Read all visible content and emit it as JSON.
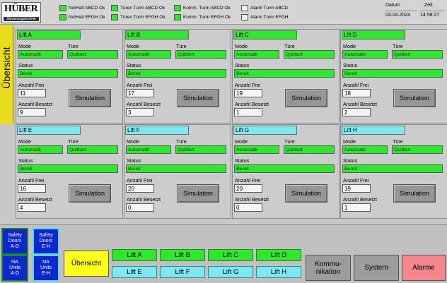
{
  "header": {
    "logo_text": "HÜBER",
    "logo_sub": "Steuerungstechnik",
    "signals": [
      {
        "label": "NotHalt ABCD Ok",
        "on": true
      },
      {
        "label": "NotHalt EFGH Ok",
        "on": true
      },
      {
        "label": "Türen Turm ABCD Ok",
        "on": true
      },
      {
        "label": "Türen Turm EFGH Ok",
        "on": true
      },
      {
        "label": "Komm. Turm ABCD Ok",
        "on": true
      },
      {
        "label": "Komm. Turm EFGH Ok",
        "on": true
      },
      {
        "label": "Alarm Turm ABCD",
        "on": false
      },
      {
        "label": "Alarm Turm EFGH",
        "on": false
      }
    ],
    "date_label": "Datum",
    "date_value": "03.04.2024",
    "time_label": "Zeit",
    "time_value": "14:58:27"
  },
  "side_tab": {
    "label": "Übersicht"
  },
  "labels": {
    "mode": "Mode",
    "door": "Türe",
    "status": "Status",
    "free": "Anzahl Frei",
    "occupied": "Anzahl Besetzt",
    "sim": "Simulation"
  },
  "lifts": [
    {
      "name": "Lift A",
      "mode": "Automatik",
      "door": "Quittiert",
      "status": "Bereit",
      "free": "11",
      "occupied": "9",
      "color": "green"
    },
    {
      "name": "Lift B",
      "mode": "Automatik",
      "door": "Quittiert",
      "status": "Bereit",
      "free": "17",
      "occupied": "3",
      "color": "green"
    },
    {
      "name": "Lift C",
      "mode": "Automatik",
      "door": "Quittiert",
      "status": "Bereit",
      "free": "19",
      "occupied": "1",
      "color": "green"
    },
    {
      "name": "Lift D",
      "mode": "Automatik",
      "door": "Quittiert",
      "status": "Bereit",
      "free": "18",
      "occupied": "2",
      "color": "green"
    },
    {
      "name": "Lift E",
      "mode": "Automatik",
      "door": "Quittiert",
      "status": "Bereit",
      "free": "16",
      "occupied": "4",
      "color": "cyan"
    },
    {
      "name": "Lift F",
      "mode": "Automatik",
      "door": "Quittiert",
      "status": "Bereit",
      "free": "20",
      "occupied": "0",
      "color": "cyan"
    },
    {
      "name": "Lift G",
      "mode": "Automatik",
      "door": "Quittiert",
      "status": "Bereit",
      "free": "20",
      "occupied": "0",
      "color": "cyan"
    },
    {
      "name": "Lift H",
      "mode": "Automatik",
      "door": "Quittiert",
      "status": "Bereit",
      "free": "19",
      "occupied": "1",
      "color": "cyan"
    }
  ],
  "footer": {
    "blue_buttons": [
      {
        "label": "Safety\nDoors\nA-D"
      },
      {
        "label": "Safety\nDoors\nE-H"
      },
      {
        "label": "NA\nUnits\nA-D"
      },
      {
        "label": "NA\nUnits\nE-H"
      }
    ],
    "overview": "Übersicht",
    "lift_buttons": [
      "Lift A",
      "Lift B",
      "Lift C",
      "Lift D",
      "Lift E",
      "Lift F",
      "Lift G",
      "Lift H"
    ],
    "communication": "Kommu-\nnikation",
    "system": "System",
    "alarms": "Alarme"
  },
  "colors": {
    "ok_green": "#2ee82e",
    "cyan": "#7de8f0",
    "yellow": "#ffff1a",
    "side_tab": "#e8dc1c",
    "alarm_pink": "#f4868c",
    "blue": "#0b27d0"
  }
}
